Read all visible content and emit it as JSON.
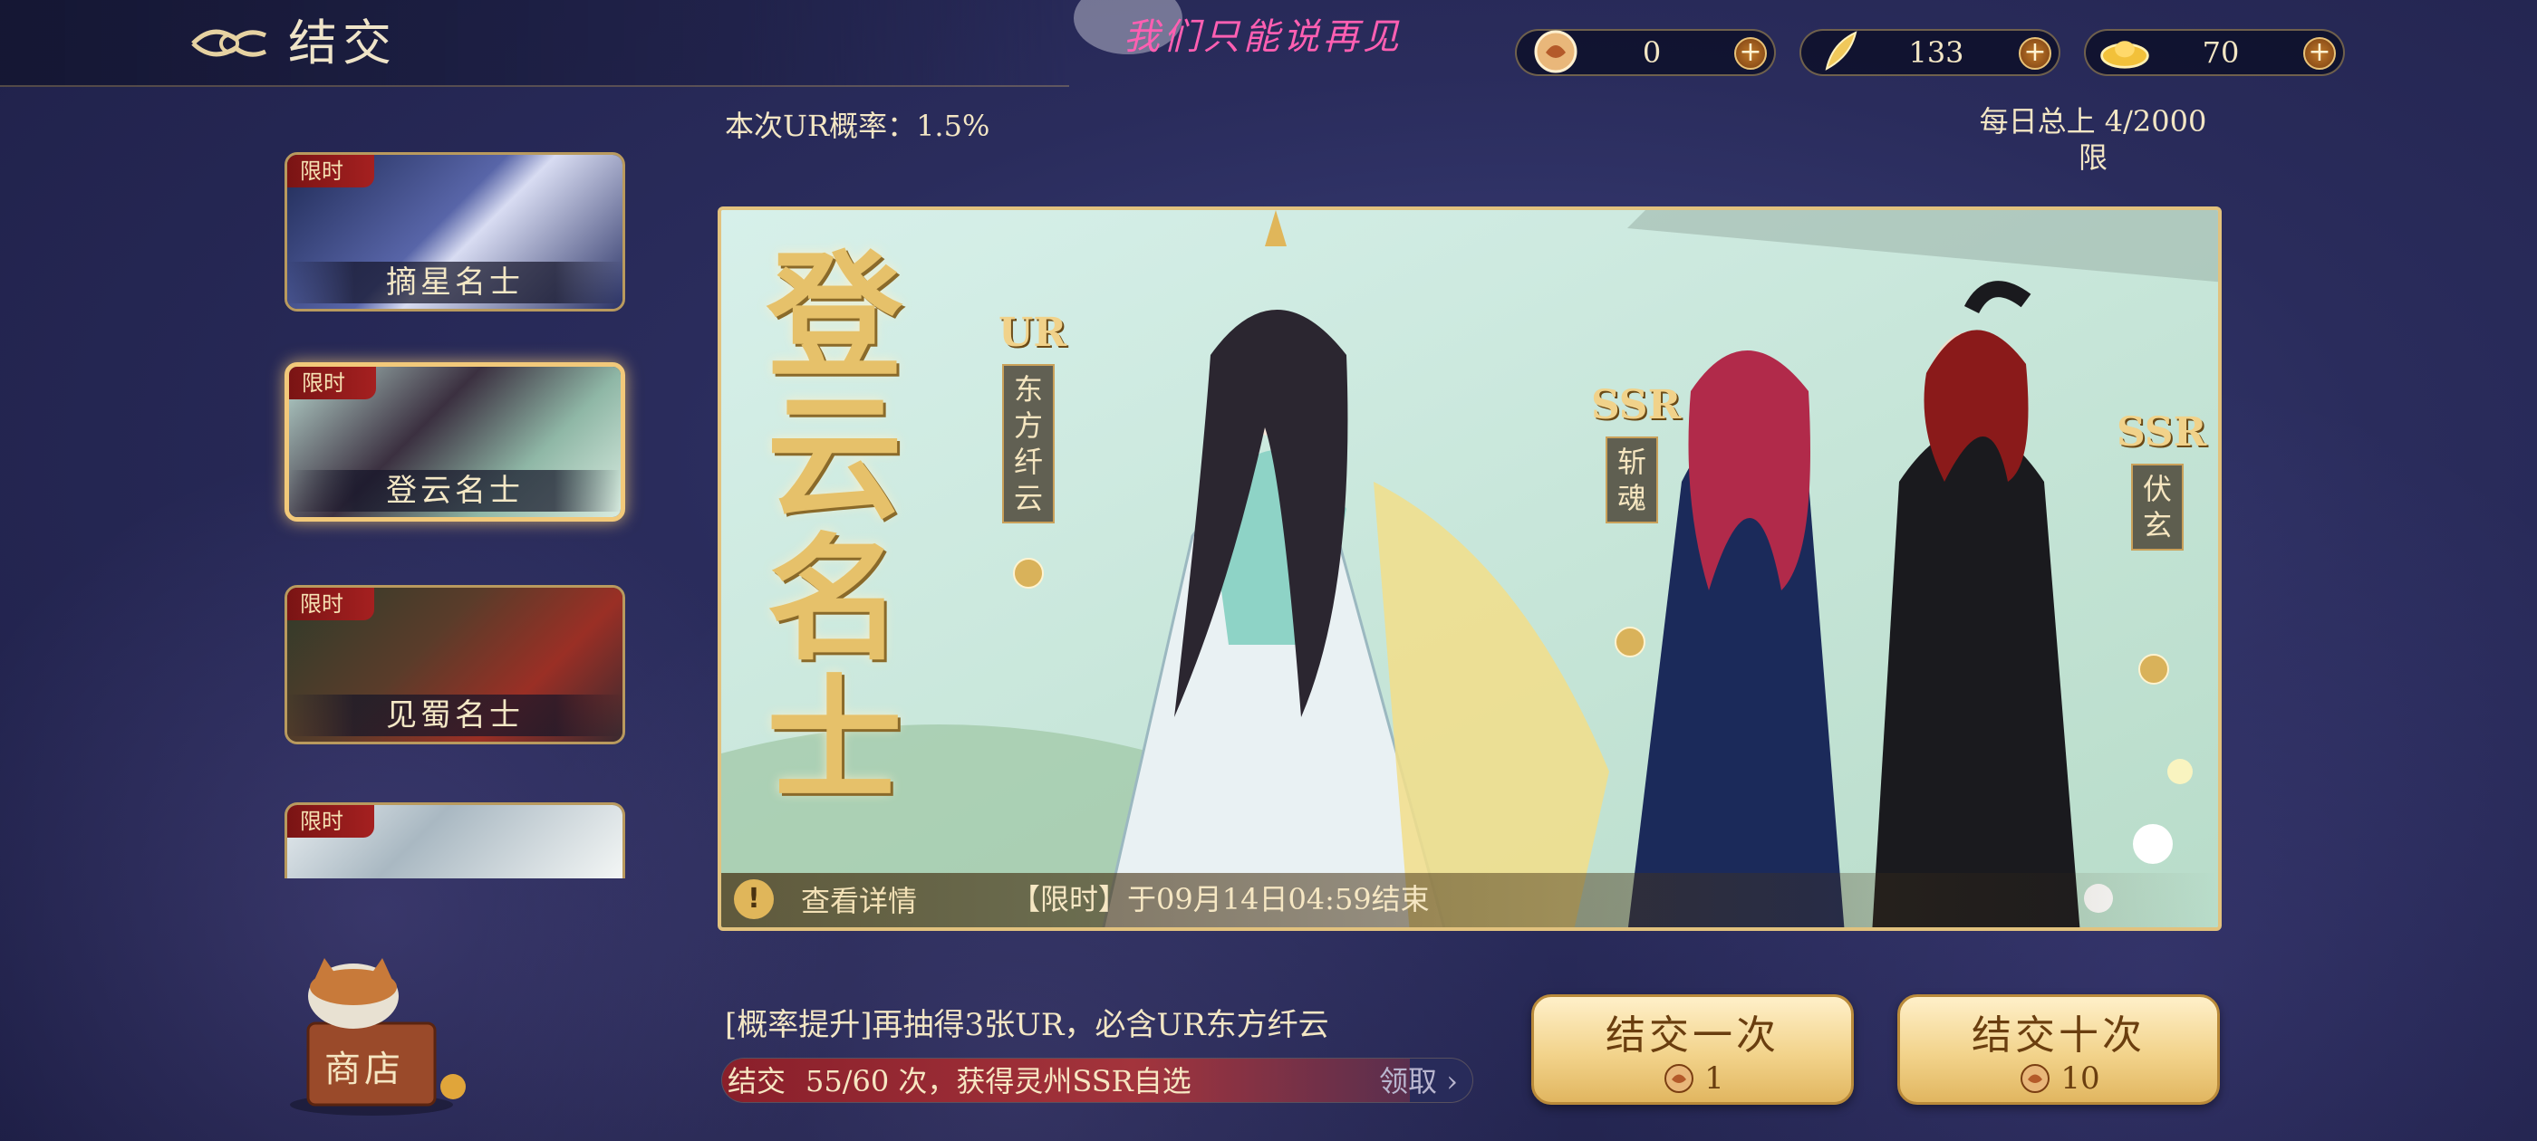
{
  "header": {
    "title": "结交",
    "overlay_text": "我们只能说再见"
  },
  "currencies": [
    {
      "icon": "summon-token-icon",
      "value": "0"
    },
    {
      "icon": "feather-icon",
      "value": "133"
    },
    {
      "icon": "gold-ingot-icon",
      "value": "70"
    }
  ],
  "info": {
    "ur_rate": "本次UR概率：1.5%",
    "daily_limit_line1": "每日总上 4/2000",
    "daily_limit_line2": "限"
  },
  "event_list": [
    {
      "badge": "限时",
      "name": "摘星名士"
    },
    {
      "badge": "限时",
      "name": "登云名士"
    },
    {
      "badge": "限时",
      "name": "见蜀名士"
    },
    {
      "badge": "限时",
      "name": ""
    }
  ],
  "shop": {
    "label": "商店"
  },
  "banner": {
    "event_title": "登云名士",
    "featured": [
      {
        "rarity": "UR",
        "name": "东方纤云"
      },
      {
        "rarity": "SSR",
        "name": "斩魂"
      },
      {
        "rarity": "SSR",
        "name": "伏玄"
      }
    ],
    "detail_label": "查看详情",
    "end_time": "【限时】于09月14日04:59结束"
  },
  "promo": {
    "text": "[概率提升]再抽得3张UR，必含UR东方纤云"
  },
  "progress": {
    "label": "结交",
    "text": "55/60 次，获得灵州SSR自选",
    "current": 55,
    "total": 60,
    "claim": "领取 ›"
  },
  "buttons": {
    "single": {
      "label": "结交一次",
      "cost": "1"
    },
    "ten": {
      "label": "结交十次",
      "cost": "10"
    }
  },
  "colors": {
    "gold": "#e2c27e",
    "badge_red": "#a52020",
    "overlay_pink": "#ff5fb2"
  }
}
